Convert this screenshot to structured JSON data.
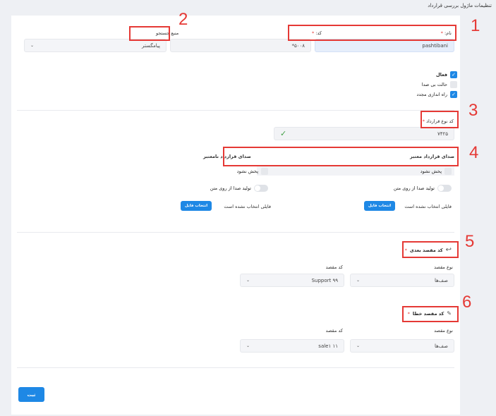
{
  "page_title": "تنظیمات ماژول بررسی قرارداد",
  "name_label": "نام:",
  "name_required": "*",
  "name_value": "pashtibani",
  "code_label": "کد:",
  "code_required": "*",
  "code_value": "*۵۰۰۸",
  "search_source_label": "منبع جستجو",
  "search_source_value": "پیامگستر",
  "checkboxes": {
    "active_label": "فعال",
    "silent_label": "حالت بی صدا",
    "restart_label": "راه اندازی مجدد"
  },
  "contract_type": {
    "label": "کد نوع قرارداد",
    "required": "*",
    "value": "۷۴۲۵"
  },
  "voice": {
    "valid_title": "صدای قرارداد معتبر",
    "invalid_title": "صدای قرارداد نامعتبر",
    "no_play_label": "پخش نشود",
    "tts_label": "تولید صدا از روی متن",
    "no_file_text": "فایلی انتخاب نشده است",
    "choose_file_label": "انتخاب فایل"
  },
  "next_dest": {
    "label": "کد مقصد بعدی",
    "required": "*",
    "type_label": "نوع مقصد",
    "type_value": "صف‌ها",
    "code_label": "کد مقصد",
    "code_value": "Support ۹۹"
  },
  "error_dest": {
    "label": "کد مقصد خطا",
    "required": "*",
    "type_label": "نوع مقصد",
    "type_value": "صف‌ها",
    "code_label": "کد مقصد",
    "code_value": "sale۱ ۱۱"
  },
  "submit_label": "ثبت",
  "annotations": [
    "1",
    "2",
    "3",
    "4",
    "5",
    "6"
  ],
  "colors": {
    "accent": "#1e88e5",
    "annotation": "#e53935",
    "check": "#43a047"
  }
}
